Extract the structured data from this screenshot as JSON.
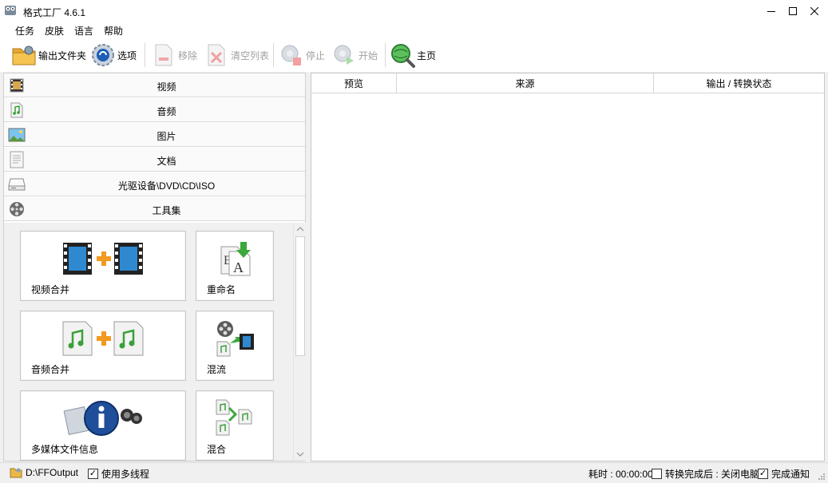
{
  "window": {
    "title": "格式工厂 4.6.1"
  },
  "menu": {
    "items": [
      "任务",
      "皮肤",
      "语言",
      "帮助"
    ]
  },
  "toolbar": {
    "output_folder": "输出文件夹",
    "options": "选项",
    "remove": "移除",
    "clear_list": "清空列表",
    "stop": "停止",
    "start": "开始",
    "home": "主页"
  },
  "categories": [
    {
      "label": "视频",
      "icon": "film-icon"
    },
    {
      "label": "音频",
      "icon": "music-note-icon"
    },
    {
      "label": "图片",
      "icon": "picture-icon"
    },
    {
      "label": "文档",
      "icon": "document-icon"
    },
    {
      "label": "光驱设备\\DVD\\CD\\ISO",
      "icon": "disc-drive-icon"
    },
    {
      "label": "工具集",
      "icon": "film-reel-icon"
    }
  ],
  "tools": [
    {
      "label": "视频合并",
      "icon": "video-merge-icon"
    },
    {
      "label": "重命名",
      "icon": "rename-icon"
    },
    {
      "label": "音频合并",
      "icon": "audio-merge-icon"
    },
    {
      "label": "混流",
      "icon": "mux-icon"
    },
    {
      "label": "多媒体文件信息",
      "icon": "media-info-icon"
    },
    {
      "label": "混合",
      "icon": "mix-icon"
    }
  ],
  "task_list": {
    "columns": [
      "预览",
      "来源",
      "输出 / 转换状态"
    ]
  },
  "status": {
    "output_path": "D:\\FFOutput",
    "multithread_label": "使用多线程",
    "multithread_checked": true,
    "elapsed": "耗时 : 00:00:00",
    "after_done_label": "转换完成后 : 关闭电脑",
    "after_done_checked": false,
    "notify_label": "完成通知",
    "notify_checked": true
  }
}
